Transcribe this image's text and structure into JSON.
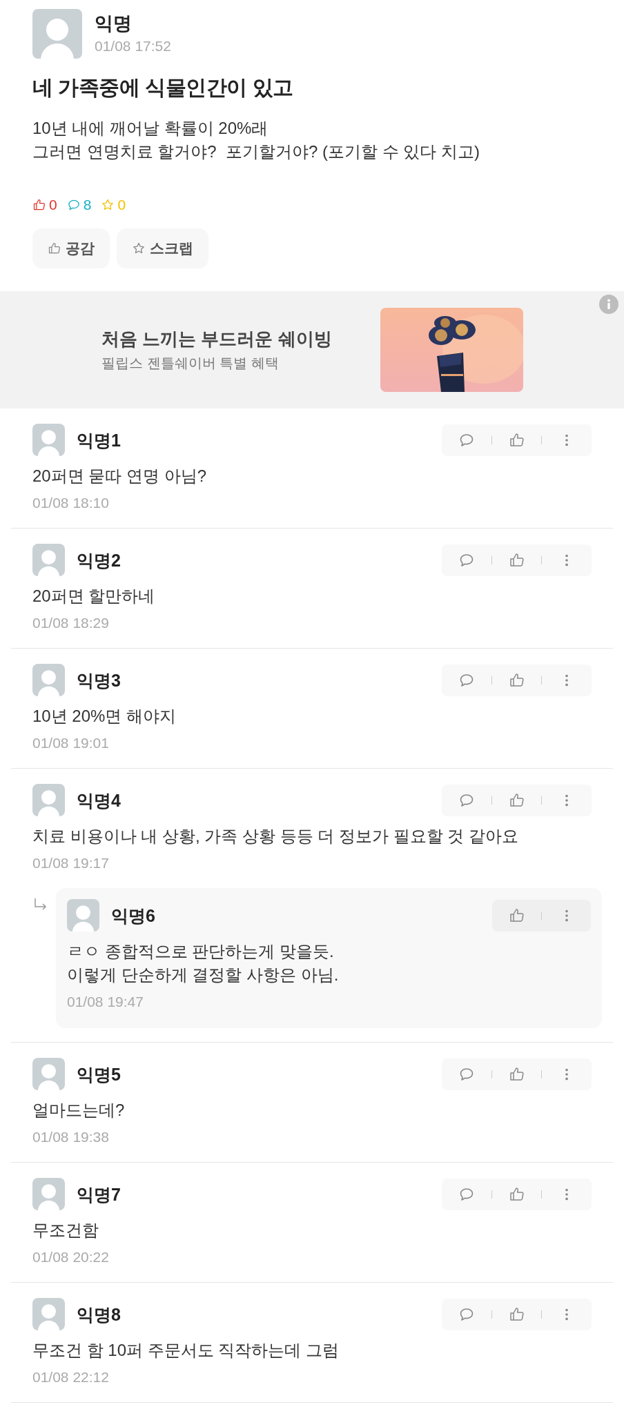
{
  "post": {
    "author": "익명",
    "time": "01/08 17:52",
    "title": "네 가족중에 식물인간이 있고",
    "body": [
      "10년 내에 깨어날 확률이 20%래",
      "그러면 연명치료 할거야?  포기할거야? (포기할 수 있다 치고)"
    ],
    "counts": [
      {
        "kind": "like",
        "value": "0",
        "color": "#e0352b"
      },
      {
        "kind": "comment",
        "value": "8",
        "color": "#17b0c2"
      },
      {
        "kind": "scrap",
        "value": "0",
        "color": "#f2c200"
      }
    ],
    "buttons": [
      {
        "kind": "like",
        "label": "공감"
      },
      {
        "kind": "scrap",
        "label": "스크랩"
      }
    ]
  },
  "ad": {
    "title": "처음 느끼는 부드러운 쉐이빙",
    "subtitle": "필립스 젠틀쉐이버 특별 혜택"
  },
  "comments": [
    {
      "author": "익명1",
      "text": [
        "20퍼면 묻따 연명 아님?"
      ],
      "time": "01/08 18:10"
    },
    {
      "author": "익명2",
      "text": [
        "20퍼면 할만하네"
      ],
      "time": "01/08 18:29"
    },
    {
      "author": "익명3",
      "text": [
        "10년 20%면 해야지"
      ],
      "time": "01/08 19:01"
    },
    {
      "author": "익명4",
      "text": [
        "치료 비용이나 내 상황, 가족 상황 등등 더 정보가 필요할 것 같아요"
      ],
      "time": "01/08 19:17",
      "replies": [
        {
          "author": "익명6",
          "text": [
            "ㄹㅇ 종합적으로 판단하는게 맞을듯.",
            "이렇게 단순하게 결정할 사항은 아님."
          ],
          "time": "01/08 19:47"
        }
      ]
    },
    {
      "author": "익명5",
      "text": [
        "얼마드는데?"
      ],
      "time": "01/08 19:38"
    },
    {
      "author": "익명7",
      "text": [
        "무조건함"
      ],
      "time": "01/08 20:22"
    },
    {
      "author": "익명8",
      "text": [
        "무조건 함 10퍼 주문서도 직작하는데 그럼"
      ],
      "time": "01/08 22:12"
    }
  ]
}
